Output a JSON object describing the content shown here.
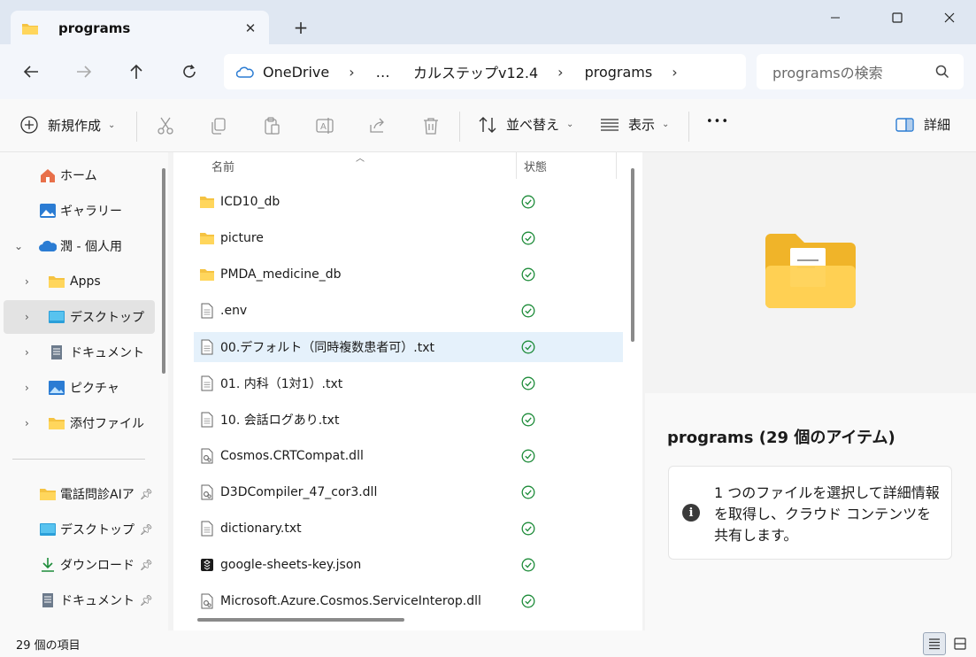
{
  "window": {
    "tab_title": "programs",
    "tab_close": "✕",
    "new_tab": "+"
  },
  "address": {
    "segments": [
      "OneDrive",
      "…",
      "カルステップv12.4",
      "programs"
    ],
    "separator": "›"
  },
  "search": {
    "placeholder": "programsの検索"
  },
  "toolbar": {
    "new_label": "新規作成",
    "sort_label": "並べ替え",
    "view_label": "表示",
    "more_label": "•••",
    "details_label": "詳細"
  },
  "sidebar": {
    "items": [
      {
        "label": "ホーム",
        "icon": "home-icon"
      },
      {
        "label": "ギャラリー",
        "icon": "gallery-icon"
      },
      {
        "label": "潤 - 個人用",
        "icon": "onedrive-cloud-icon"
      },
      {
        "label": "Apps",
        "icon": "folder-icon"
      },
      {
        "label": "デスクトップ",
        "icon": "desktop-icon"
      },
      {
        "label": "ドキュメント",
        "icon": "document-icon"
      },
      {
        "label": "ピクチャ",
        "icon": "picture-icon"
      },
      {
        "label": "添付ファイル",
        "icon": "folder-icon"
      }
    ],
    "quick_access": [
      {
        "label": "電話問診AIア",
        "icon": "folder-icon"
      },
      {
        "label": "デスクトップ",
        "icon": "desktop-icon"
      },
      {
        "label": "ダウンロード",
        "icon": "download-icon"
      },
      {
        "label": "ドキュメント",
        "icon": "document-icon"
      }
    ]
  },
  "filelist": {
    "columns": {
      "name": "名前",
      "status": "状態"
    },
    "files": [
      {
        "name": "ICD10_db",
        "type": "folder"
      },
      {
        "name": "picture",
        "type": "folder"
      },
      {
        "name": "PMDA_medicine_db",
        "type": "folder"
      },
      {
        "name": ".env",
        "type": "text"
      },
      {
        "name": "00.デフォルト（同時複数患者可）.txt",
        "type": "text"
      },
      {
        "name": "01. 内科（1対1）.txt",
        "type": "text"
      },
      {
        "name": "10. 会話ログあり.txt",
        "type": "text"
      },
      {
        "name": "Cosmos.CRTCompat.dll",
        "type": "dll"
      },
      {
        "name": "D3DCompiler_47_cor3.dll",
        "type": "dll"
      },
      {
        "name": "dictionary.txt",
        "type": "text"
      },
      {
        "name": "google-sheets-key.json",
        "type": "json"
      },
      {
        "name": "Microsoft.Azure.Cosmos.ServiceInterop.dll",
        "type": "dll"
      }
    ],
    "selected_index": 4
  },
  "details": {
    "title": "programs (29 個のアイテム)",
    "info_text": "1 つのファイルを選択して詳細情報を取得し、クラウド コンテンツを共有します。",
    "info_icon": "i"
  },
  "statusbar": {
    "item_count": "29 個の項目"
  },
  "colors": {
    "folder": "#f5c342",
    "sync_green": "#1e8c3a",
    "onedrive_blue": "#2b7cd3",
    "selection": "#e5f1fb"
  }
}
